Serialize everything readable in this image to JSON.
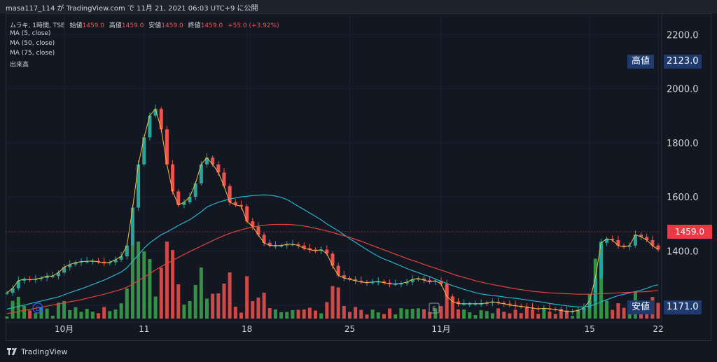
{
  "header": {
    "text": "masa117_114 が TradingView.com で 11月 21, 2021 06:03 UTC+9 に公開"
  },
  "legend": {
    "symbol": "ムラキ, 1時間, TSE",
    "ohlc_label": "始値",
    "ohlc_open": "1459.0",
    "high_label": "高値",
    "high_value": "1459.0",
    "low_label": "安値",
    "low_value": "1459.0",
    "close_label": "終値",
    "close_value": "1459.0",
    "change": "+55.0 (+3.92%)",
    "ma1": "MA (5, close)",
    "ma2": "MA (50, close)",
    "ma3": "MA (75, close)",
    "volume": "出来高"
  },
  "tags": {
    "high_label": "高値",
    "high_value": "2123.0",
    "low_label": "安値",
    "low_value": "1171.0",
    "last_price": "1459.0"
  },
  "markers": {
    "dividend": "D",
    "earnings": "E"
  },
  "footer": {
    "brand": "TradingView"
  },
  "colors": {
    "up": "#26a69a",
    "down": "#ef5350",
    "ma5": "#f0c040",
    "ma50": "#26b5c8",
    "ma75": "#e0443a",
    "vol_up": "#3aa84a"
  },
  "chart_data": {
    "type": "line",
    "y_ticks": [
      "2200.0",
      "2000.0",
      "1800.0",
      "1600.0",
      "1400.0",
      "1200.0"
    ],
    "y_tick_values": [
      2200,
      2000,
      1800,
      1600,
      1400,
      1200
    ],
    "ylim": [
      1150,
      2250
    ],
    "x_ticks": [
      "10月",
      "11",
      "18",
      "25",
      "11月",
      "15",
      "22"
    ],
    "x_tick_index": [
      10,
      24,
      42,
      60,
      76,
      102,
      114
    ],
    "n_bars": 115,
    "series": [
      {
        "name": "MA (5, close)",
        "values": [
          1245,
          1262,
          1290,
          1296,
          1293,
          1296,
          1300,
          1307,
          1307,
          1320,
          1340,
          1350,
          1357,
          1361,
          1362,
          1363,
          1360,
          1355,
          1358,
          1368,
          1380,
          1420,
          1560,
          1720,
          1820,
          1900,
          1925,
          1850,
          1720,
          1620,
          1570,
          1580,
          1600,
          1650,
          1720,
          1745,
          1720,
          1690,
          1640,
          1580,
          1570,
          1565,
          1510,
          1490,
          1460,
          1430,
          1420,
          1420,
          1420,
          1425,
          1425,
          1420,
          1410,
          1405,
          1400,
          1405,
          1390,
          1345,
          1310,
          1300,
          1295,
          1290,
          1285,
          1283,
          1285,
          1287,
          1283,
          1278,
          1278,
          1280,
          1285,
          1295,
          1298,
          1292,
          1286,
          1290,
          1278,
          1232,
          1213,
          1205,
          1205,
          1205,
          1205,
          1205,
          1208,
          1212,
          1208,
          1205,
          1200,
          1197,
          1195,
          1192,
          1188,
          1186,
          1188,
          1186,
          1183,
          1180,
          1176,
          1177,
          1180,
          1190,
          1215,
          1300,
          1430,
          1445,
          1440,
          1420,
          1415,
          1420,
          1460,
          1452,
          1440,
          1420,
          1405
        ]
      },
      {
        "name": "MA (50, close)",
        "values": [
          1185,
          1190,
          1195,
          1200,
          1205,
          1210,
          1215,
          1220,
          1225,
          1230,
          1238,
          1246,
          1253,
          1260,
          1268,
          1276,
          1284,
          1292,
          1302,
          1312,
          1322,
          1338,
          1362,
          1385,
          1410,
          1430,
          1445,
          1460,
          1470,
          1482,
          1494,
          1505,
          1516,
          1530,
          1545,
          1562,
          1572,
          1580,
          1586,
          1592,
          1596,
          1600,
          1602,
          1605,
          1606,
          1607,
          1606,
          1603,
          1598,
          1590,
          1578,
          1565,
          1553,
          1540,
          1528,
          1515,
          1500,
          1487,
          1474,
          1460,
          1445,
          1432,
          1418,
          1405,
          1392,
          1380,
          1370,
          1362,
          1353,
          1344,
          1335,
          1327,
          1320,
          1312,
          1305,
          1296,
          1288,
          1280,
          1272,
          1265,
          1258,
          1252,
          1246,
          1241,
          1238,
          1235,
          1233,
          1230,
          1227,
          1225,
          1222,
          1219,
          1216,
          1213,
          1210,
          1206,
          1203,
          1200,
          1197,
          1195,
          1193,
          1193,
          1196,
          1203,
          1212,
          1220,
          1228,
          1235,
          1240,
          1245,
          1250,
          1255,
          1262,
          1270,
          1275
        ]
      },
      {
        "name": "MA (75, close)",
        "values": [
          1168,
          1172,
          1176,
          1180,
          1184,
          1188,
          1192,
          1196,
          1200,
          1204,
          1208,
          1212,
          1216,
          1220,
          1225,
          1230,
          1235,
          1240,
          1246,
          1252,
          1258,
          1266,
          1277,
          1290,
          1303,
          1316,
          1330,
          1342,
          1354,
          1365,
          1376,
          1387,
          1398,
          1408,
          1418,
          1428,
          1438,
          1448,
          1457,
          1465,
          1472,
          1478,
          1484,
          1488,
          1492,
          1495,
          1497,
          1498,
          1498,
          1498,
          1497,
          1495,
          1492,
          1488,
          1484,
          1479,
          1474,
          1468,
          1462,
          1456,
          1450,
          1443,
          1436,
          1428,
          1420,
          1412,
          1404,
          1396,
          1388,
          1380,
          1372,
          1365,
          1358,
          1350,
          1343,
          1336,
          1329,
          1322,
          1315,
          1308,
          1302,
          1296,
          1290,
          1285,
          1280,
          1276,
          1272,
          1268,
          1264,
          1260,
          1257,
          1254,
          1251,
          1249,
          1247,
          1245,
          1244,
          1243,
          1242,
          1241,
          1240,
          1240,
          1240,
          1241,
          1242,
          1243,
          1244,
          1245,
          1246,
          1247,
          1248,
          1249,
          1250,
          1252,
          1254
        ]
      }
    ]
  }
}
